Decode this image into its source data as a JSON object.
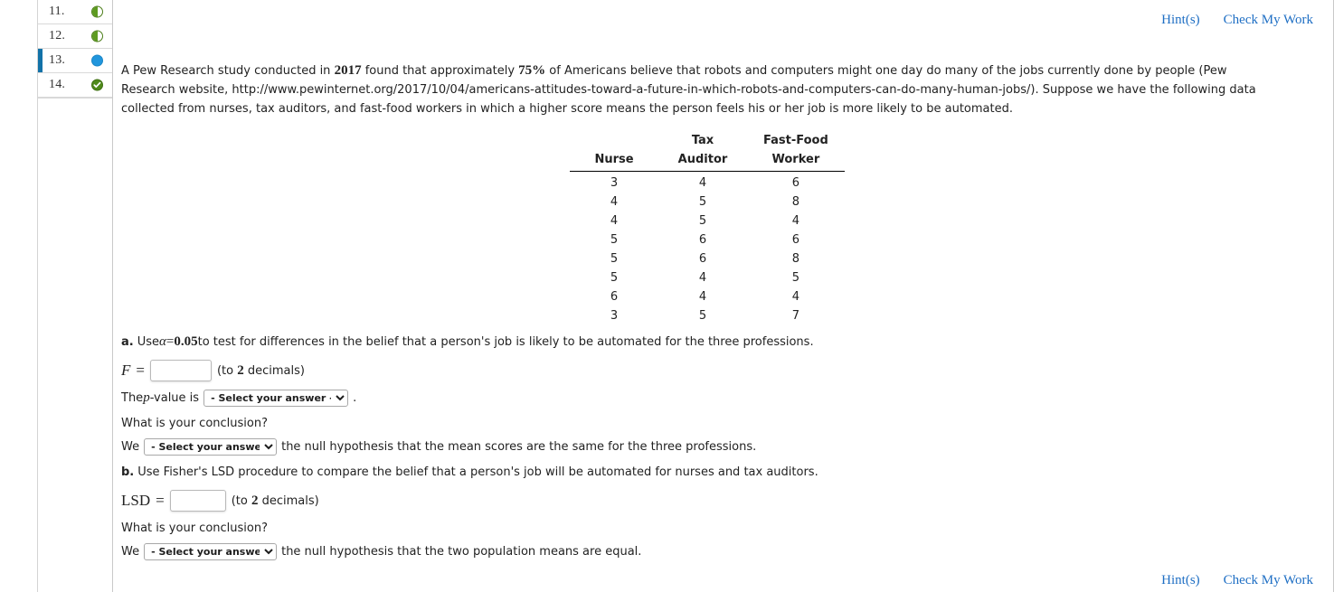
{
  "sidebar": {
    "items": [
      {
        "number": "11.",
        "status": "partial",
        "active": false
      },
      {
        "number": "12.",
        "status": "partial",
        "active": false
      },
      {
        "number": "13.",
        "status": "current",
        "active": true
      },
      {
        "number": "14.",
        "status": "complete",
        "active": false
      }
    ]
  },
  "toolbar": {
    "hint_label": "Hint(s)",
    "check_label": "Check My Work"
  },
  "problem": {
    "intro_part1": "A Pew Research study conducted in ",
    "intro_year": "2017",
    "intro_part2": " found that approximately ",
    "intro_pct": "75%",
    "intro_part3": " of Americans believe that robots and computers might one day do many of the jobs currently done by people (Pew Research website, http://www.pewinternet.org/2017/10/04/americans-attitudes-toward-a-future-in-which-robots-and-computers-can-do-many-human-jobs/). Suppose we have the following data collected from nurses, tax auditors, and fast-food workers in which a higher score means the person feels his or her job is more likely to be automated."
  },
  "table": {
    "headers": [
      {
        "line1": "",
        "line2": "Nurse"
      },
      {
        "line1": "Tax",
        "line2": "Auditor"
      },
      {
        "line1": "Fast-Food",
        "line2": "Worker"
      }
    ],
    "rows": [
      [
        "3",
        "4",
        "6"
      ],
      [
        "4",
        "5",
        "8"
      ],
      [
        "4",
        "5",
        "4"
      ],
      [
        "5",
        "6",
        "6"
      ],
      [
        "5",
        "6",
        "8"
      ],
      [
        "5",
        "4",
        "5"
      ],
      [
        "6",
        "4",
        "4"
      ],
      [
        "3",
        "5",
        "7"
      ]
    ]
  },
  "part_a": {
    "label": "a.",
    "text_before_alpha": "Use ",
    "alpha_symbol": "α",
    "equals": " = ",
    "alpha_value": "0.05",
    "text_after_alpha": " to test for differences in the belief that a person's job is likely to be automated for the three professions.",
    "f_symbol": "F",
    "f_equals": "=",
    "f_value": "",
    "f_placeholder": "",
    "f_note": "(to ",
    "f_decimals": "2",
    "f_note_end": " decimals)",
    "pvalue_prefix_1": "The ",
    "pvalue_p": "p",
    "pvalue_prefix_2": "-value is",
    "pvalue_select": "- Select your answer -",
    "pvalue_suffix": ".",
    "conclusion_prompt": "What is your conclusion?",
    "conclusion_we": "We",
    "conclusion_select": "- Select your answer -",
    "conclusion_text": "the null hypothesis that the mean scores are the same for the three professions."
  },
  "part_b": {
    "label": "b.",
    "text": "Use Fisher's LSD procedure to compare the belief that a person's job will be automated for nurses and tax auditors.",
    "lsd_symbol": "LSD",
    "lsd_equals": "=",
    "lsd_value": "",
    "lsd_placeholder": "",
    "lsd_note": "(to ",
    "lsd_decimals": "2",
    "lsd_note_end": " decimals)",
    "conclusion_prompt": "What is your conclusion?",
    "conclusion_we": "We",
    "conclusion_select": "- Select your answer -",
    "conclusion_text": "the null hypothesis that the two population means are equal."
  },
  "select_options": {
    "placeholder": "- Select your answer -"
  },
  "colors": {
    "link_blue": "#1f6fc4",
    "active_marker": "#1272a8",
    "status_green": "#5d9b20",
    "status_blue": "#2196dd"
  }
}
